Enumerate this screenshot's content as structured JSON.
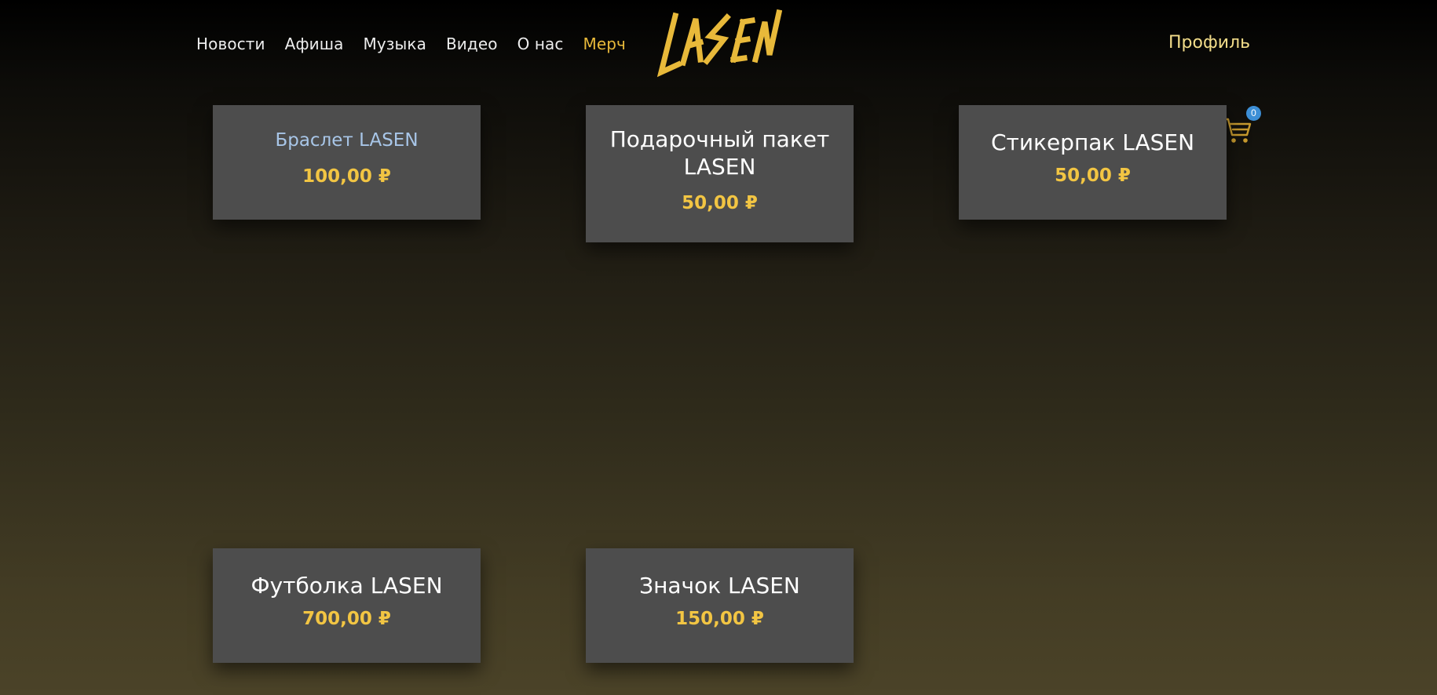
{
  "nav": {
    "items": [
      {
        "label": "Новости",
        "active": false
      },
      {
        "label": "Афиша",
        "active": false
      },
      {
        "label": "Музыка",
        "active": false
      },
      {
        "label": "Видео",
        "active": false
      },
      {
        "label": "О нас",
        "active": false
      },
      {
        "label": "Мерч",
        "active": true
      }
    ]
  },
  "logo": {
    "text": "LASEN",
    "color": "#e8b93a"
  },
  "profile": {
    "label": "Профиль"
  },
  "cart": {
    "icon": "cart-icon",
    "count": "0"
  },
  "products": [
    {
      "name": "Браслет LASEN",
      "price": "100,00 ₽"
    },
    {
      "name": "Подарочный пакет LASEN",
      "price": "50,00 ₽"
    },
    {
      "name": "Стикерпак LASEN",
      "price": "50,00 ₽"
    },
    {
      "name": "Футболка LASEN",
      "price": "700,00 ₽"
    },
    {
      "name": "Значок LASEN",
      "price": "150,00 ₽"
    }
  ],
  "colors": {
    "accent": "#e8b93a",
    "price": "#f2c543",
    "card_bg": "#4d4d4d",
    "badge": "#3d8fd6"
  }
}
